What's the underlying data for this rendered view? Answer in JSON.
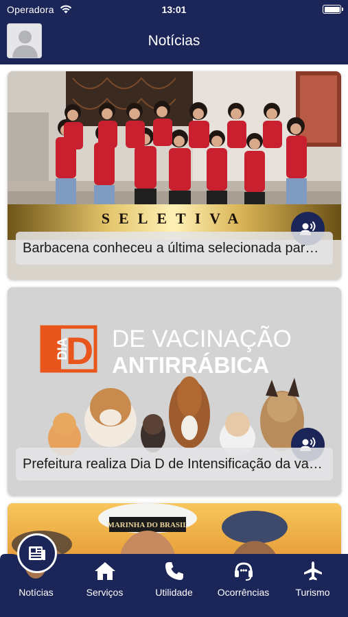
{
  "status_bar": {
    "carrier": "Operadora",
    "time": "13:01"
  },
  "header": {
    "title": "Notícias"
  },
  "news": [
    {
      "banner_text": "SELETIVA",
      "caption": "Barbacena conheceu a última selecionada para o concurso"
    },
    {
      "banner_dia": "DIA",
      "banner_d": "D",
      "banner_line1": "DE VACINAÇÃO",
      "banner_line2": "ANTIRRÁBICA",
      "caption": "Prefeitura realiza Dia D de Intensificação da vacinação antirrábica"
    },
    {
      "banner_text": "MARINHA DO BRASIL"
    }
  ],
  "tabs": [
    {
      "label": "Notícias",
      "icon": "newspaper-icon",
      "active": true
    },
    {
      "label": "Serviços",
      "icon": "home-icon"
    },
    {
      "label": "Utilidade",
      "icon": "phone-icon"
    },
    {
      "label": "Ocorrências",
      "icon": "headset-icon"
    },
    {
      "label": "Turismo",
      "icon": "airplane-icon"
    }
  ],
  "colors": {
    "primary": "#1b2558",
    "gold": "#c9a545",
    "red_shirt": "#c8202e",
    "orange": "#e8561c"
  }
}
